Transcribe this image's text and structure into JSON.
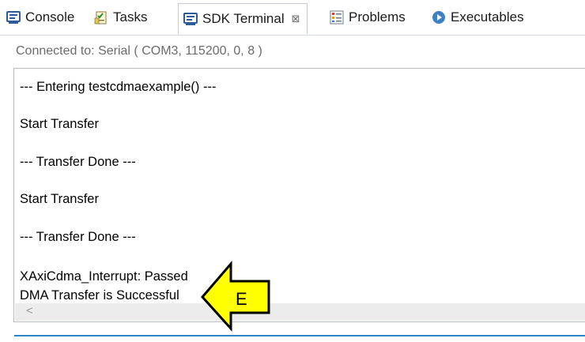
{
  "tabs": [
    {
      "label": "Console",
      "icon": "console-icon"
    },
    {
      "label": "Tasks",
      "icon": "tasks-icon"
    },
    {
      "label": "SDK Terminal",
      "icon": "terminal-icon",
      "active": true,
      "close_glyph": "⊠"
    },
    {
      "label": "Problems",
      "icon": "problems-icon"
    },
    {
      "label": "Executables",
      "icon": "executables-icon"
    }
  ],
  "status": "Connected to: Serial ( COM3, 115200, 0, 8 )",
  "console_lines": [
    "--- Entering testcdmaexample() ---",
    "Start Transfer",
    "--- Transfer Done ---",
    "Start Transfer",
    "--- Transfer Done ---",
    "XAxiCdma_Interrupt: Passed",
    "DMA Transfer is Successful"
  ],
  "scroll": {
    "left_arrow": "<"
  },
  "annotation": {
    "label": "E",
    "fill": "#ffff00",
    "stroke": "#000000",
    "icon": "arrow-left-icon"
  },
  "colors": {
    "accent": "#2e86c9",
    "status_text": "#6b6b6b"
  }
}
